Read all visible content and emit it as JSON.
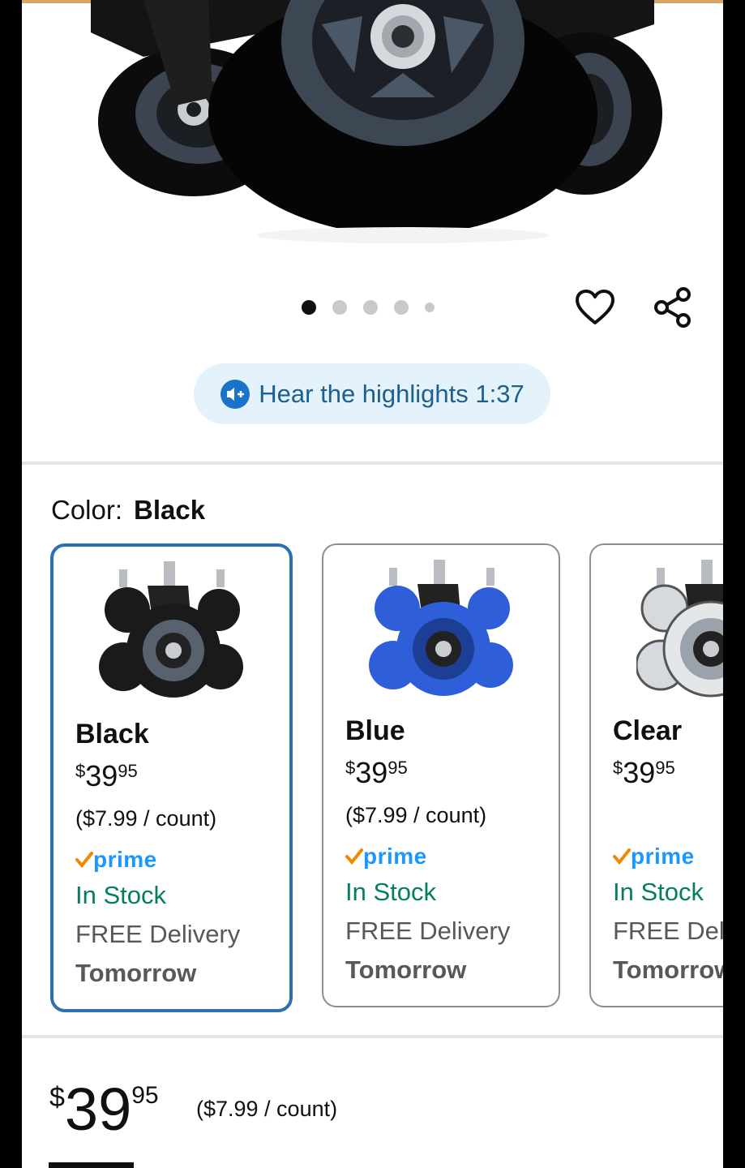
{
  "gallery": {
    "dot_count": 5,
    "active_index": 0
  },
  "audio": {
    "label": "Hear the highlights 1:37"
  },
  "color_selector": {
    "label": "Color:",
    "selected_value": "Black"
  },
  "variants": [
    {
      "name": "Black",
      "price_currency": "$",
      "price_whole": "39",
      "price_fraction": "95",
      "unit_price": "($7.99 / count)",
      "prime": "prime",
      "stock": "In Stock",
      "delivery": "FREE Delivery",
      "delivery_date": "Tomorrow",
      "wheel_color": "#1a1a1a"
    },
    {
      "name": "Blue",
      "price_currency": "$",
      "price_whole": "39",
      "price_fraction": "95",
      "unit_price": "($7.99 / count)",
      "prime": "prime",
      "stock": "In Stock",
      "delivery": "FREE Delivery",
      "delivery_date": "Tomorrow",
      "wheel_color": "#2f5fd8"
    },
    {
      "name": "Clear",
      "price_currency": "$",
      "price_whole": "39",
      "price_fraction": "95",
      "unit_price": "",
      "prime": "prime",
      "stock": "In Stock",
      "delivery": "FREE Delivery",
      "delivery_date": "Tomorrow",
      "wheel_color": "#d6dadf"
    }
  ],
  "price": {
    "currency": "$",
    "whole": "39",
    "fraction": "95",
    "unit_price": "($7.99 / count)"
  },
  "colors": {
    "accent_blue": "#2e6fb0",
    "prime_blue": "#1a98ff",
    "prime_check": "#f08804",
    "stock_green": "#067d62",
    "highlight_bg": "#e3f2fb"
  }
}
